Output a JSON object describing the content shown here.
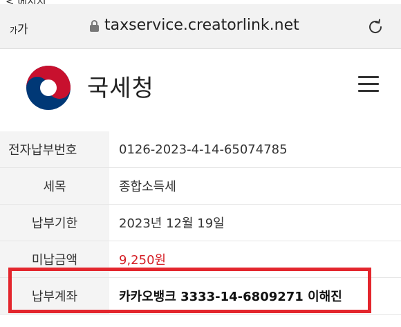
{
  "browser": {
    "top_fragment": "< 메시지",
    "text_size_label_small": "가",
    "text_size_label_large": "가",
    "url": "taxservice.creatorlink.net",
    "icons": {
      "lock": "lock-icon",
      "reload": "reload-icon"
    }
  },
  "header": {
    "org_name": "국세청",
    "logo": "taegeuk-logo",
    "menu_icon": "hamburger-menu-icon",
    "colors": {
      "red": "#c8102e",
      "blue": "#003876",
      "alert": "#e3262d"
    }
  },
  "details": [
    {
      "label": "전자납부번호",
      "value": "0126-2023-4-14-65074785"
    },
    {
      "label": "세목",
      "value": "종합소득세"
    },
    {
      "label": "납부기한",
      "value": "2023년 12월 19일"
    },
    {
      "label": "미납금액",
      "value": "9,250원"
    },
    {
      "label": "납부계좌",
      "value": "카카오뱅크 3333-14-6809271 이해진"
    }
  ]
}
